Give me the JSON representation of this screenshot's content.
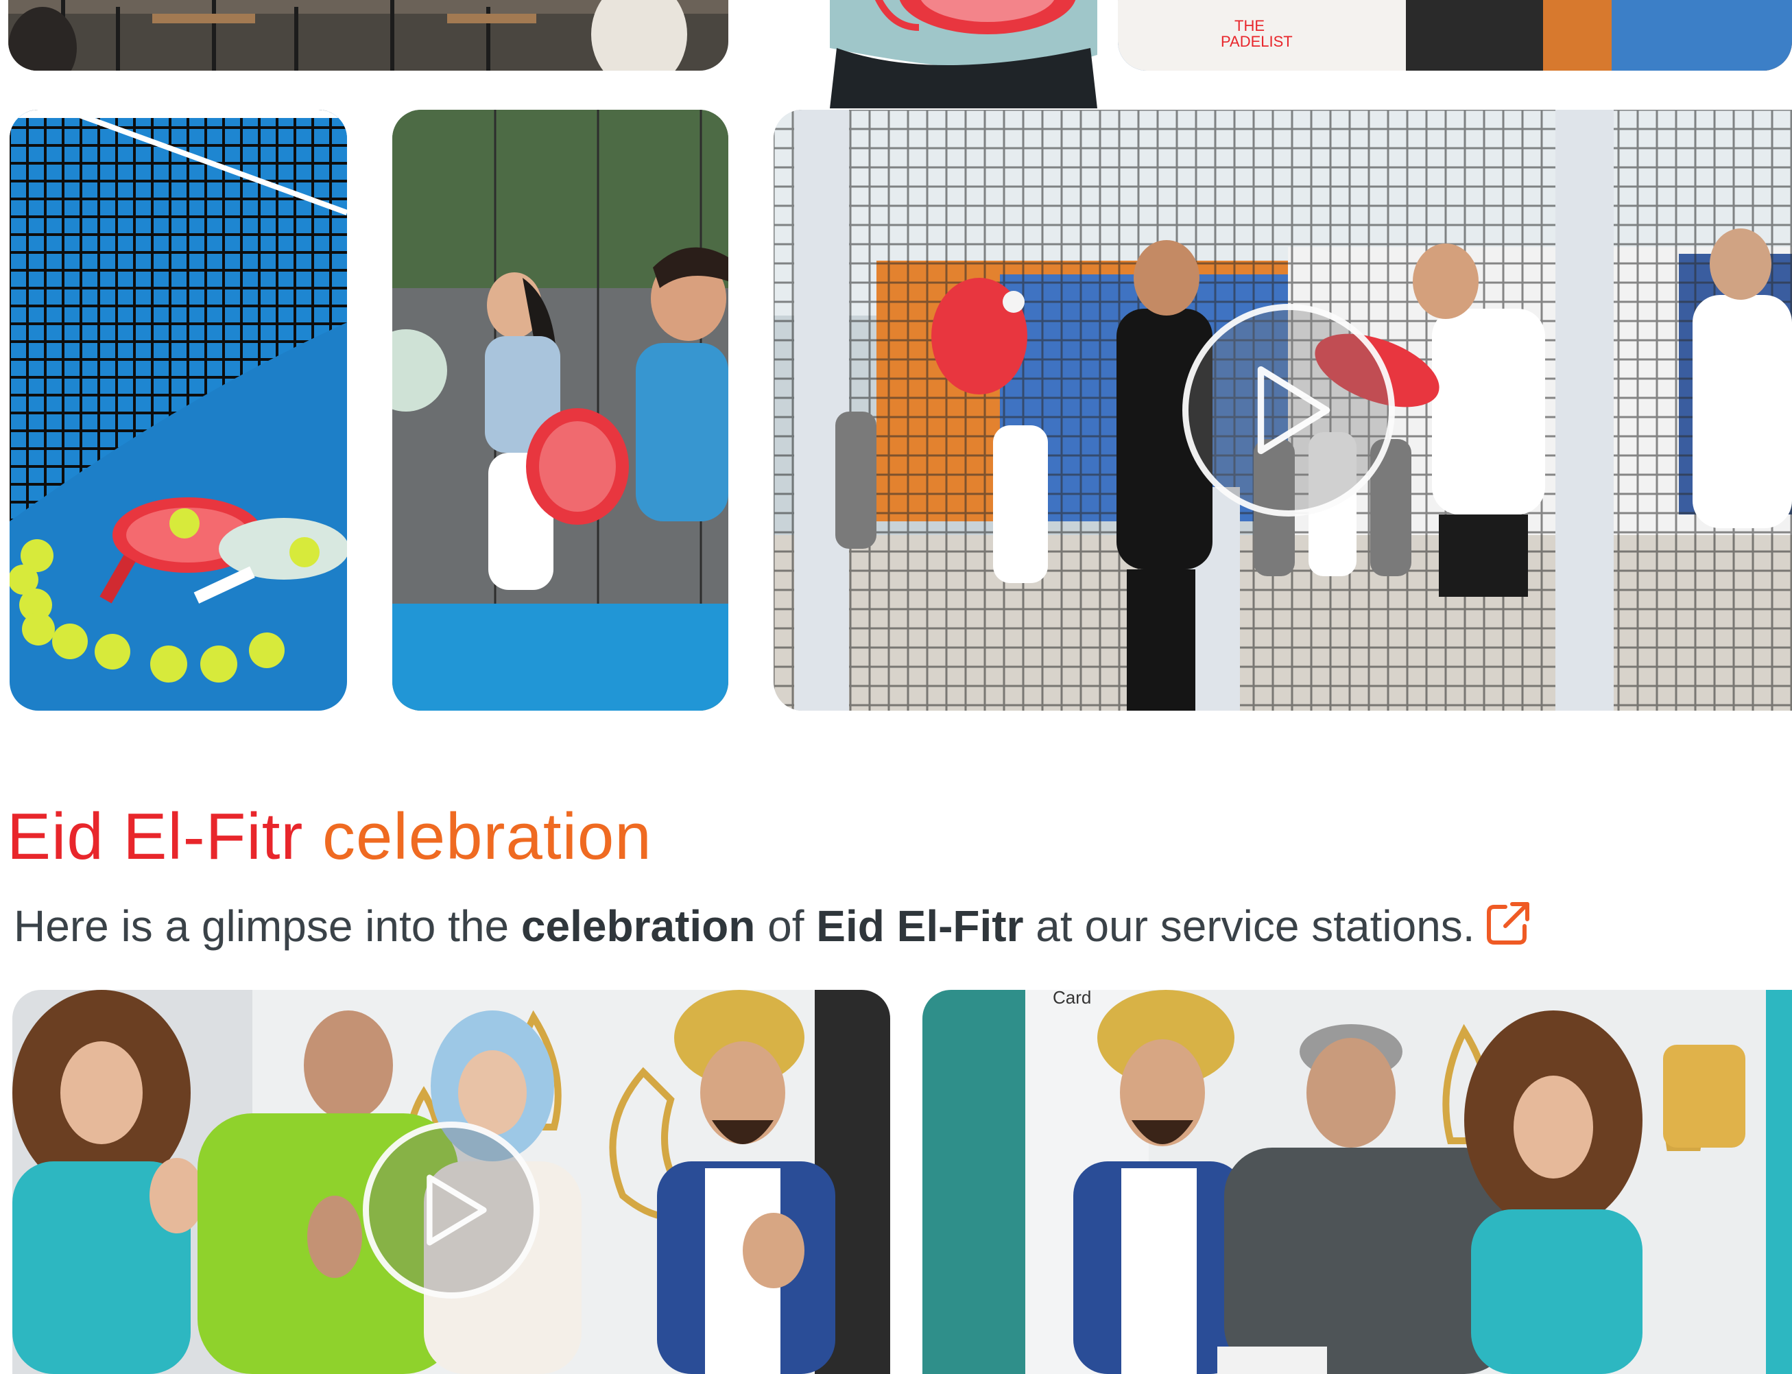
{
  "section": {
    "title_part1": "Eid El-Fitr",
    "title_part2": "celebration",
    "intro_start": "Here is a glimpse into the ",
    "intro_bold1": "celebration",
    "intro_mid": " of ",
    "intro_bold2": "Eid El-Fitr",
    "intro_end": " at our service stations.",
    "link_icon": "external-link-icon"
  },
  "gallery_top": [
    {
      "alt": "padel-event-crowd-photo"
    },
    {
      "alt": "padel-player-paddle-photo"
    },
    {
      "alt": "the-padelist-shirt-photo"
    }
  ],
  "gallery_padel": [
    {
      "alt": "padel-rackets-and-balls-photo"
    },
    {
      "alt": "padel-players-ready-photo"
    },
    {
      "alt": "padel-opening-ceremony-video",
      "has_play": true
    }
  ],
  "gallery_eid": [
    {
      "alt": "eid-thumbs-up-video",
      "has_play": true
    },
    {
      "alt": "eid-group-portrait-photo"
    }
  ],
  "colors": {
    "title_red": "#e8262b",
    "title_orange": "#ef6a21",
    "body_text": "#3a4248",
    "court_blue": "#1e86d1"
  }
}
